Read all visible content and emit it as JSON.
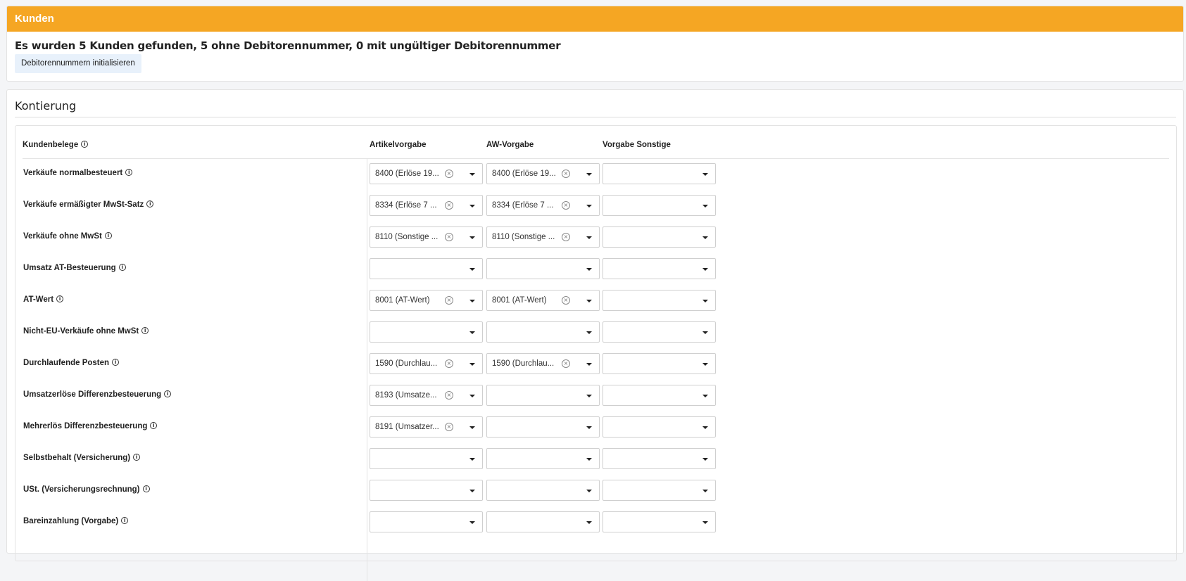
{
  "kunden": {
    "title": "Kunden",
    "summary": "Es wurden 5 Kunden gefunden, 5 ohne Debitorennummer, 0 mit ungültiger Debitorennummer",
    "init_button": "Debitorennummern initialisieren"
  },
  "kontierung": {
    "title": "Kontierung",
    "headers": {
      "kundenbelege": "Kundenbelege",
      "artikel": "Artikelvorgabe",
      "aw": "AW-Vorgabe",
      "sonstige": "Vorgabe Sonstige"
    },
    "info_glyph": "i",
    "clear_glyph": "×",
    "rows": [
      {
        "label": "Verkäufe normalbesteuert",
        "artikel": "8400 (Erlöse 19...",
        "aw": "8400 (Erlöse 19...",
        "sonstige": ""
      },
      {
        "label": "Verkäufe ermäßigter MwSt-Satz",
        "artikel": "8334 (Erlöse 7 ...",
        "aw": "8334 (Erlöse 7 ...",
        "sonstige": ""
      },
      {
        "label": "Verkäufe ohne MwSt",
        "artikel": "8110 (Sonstige ...",
        "aw": "8110 (Sonstige ...",
        "sonstige": ""
      },
      {
        "label": "Umsatz AT-Besteuerung",
        "artikel": "",
        "aw": "",
        "sonstige": ""
      },
      {
        "label": "AT-Wert",
        "artikel": "8001 (AT-Wert)",
        "aw": "8001 (AT-Wert)",
        "sonstige": ""
      },
      {
        "label": "Nicht-EU-Verkäufe ohne MwSt",
        "artikel": "",
        "aw": "",
        "sonstige": ""
      },
      {
        "label": "Durchlaufende Posten",
        "artikel": "1590 (Durchlau...",
        "aw": "1590 (Durchlau...",
        "sonstige": ""
      },
      {
        "label": "Umsatzerlöse Differenzbesteuerung",
        "artikel": "8193 (Umsatze...",
        "aw": "",
        "sonstige": ""
      },
      {
        "label": "Mehrerlös Differenzbesteuerung",
        "artikel": "8191 (Umsatzer...",
        "aw": "",
        "sonstige": ""
      },
      {
        "label": "Selbstbehalt (Versicherung)",
        "artikel": "",
        "aw": "",
        "sonstige": ""
      },
      {
        "label": "USt. (Versicherungsrechnung)",
        "artikel": "",
        "aw": "",
        "sonstige": ""
      },
      {
        "label": "Bareinzahlung (Vorgabe)",
        "artikel": "",
        "aw": "",
        "sonstige": ""
      }
    ]
  },
  "colors": {
    "header": "#f5a623",
    "button_bg": "#e8f1fb"
  }
}
